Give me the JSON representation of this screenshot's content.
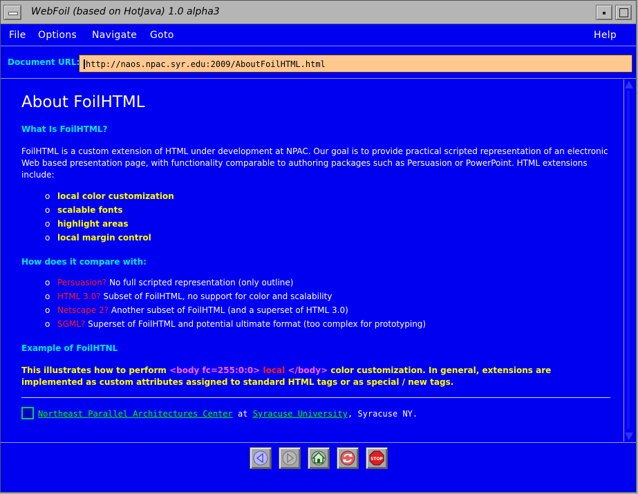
{
  "window": {
    "title": "WebFoil (based on HotJava) 1.0 alpha3"
  },
  "menubar": {
    "file": "File",
    "options": "Options",
    "navigate": "Navigate",
    "goto": "Goto",
    "help": "Help"
  },
  "url": {
    "label": "Document URL:",
    "value": "http://naos.npac.syr.edu:2009/AboutFoilHTML.html"
  },
  "page": {
    "title": "About FoilHTML",
    "section1_heading": "What Is FoilHTML?",
    "intro": "FoilHTML is a custom extension of HTML under development at NPAC. Our goal is to provide practical scripted representation of an electronic Web based presentation page, with functionality comparable to authoring packages such as Persuasion or PowerPoint. HTML extensions include:",
    "bullet_marker": "o",
    "features": [
      "local color customization",
      "scalable fonts",
      "highlight areas",
      "local margin control"
    ],
    "section2_heading": "How does it compare with:",
    "comparisons": [
      {
        "name": "Persuasion?",
        "desc": "No full scripted representation (only outline)"
      },
      {
        "name": "HTML 3.0?",
        "desc": "Subset of FoilHTML, no support for color and scalability"
      },
      {
        "name": "Netscape 2?",
        "desc": "Another subset of FoilHTML (and a superset of HTML 3.0)"
      },
      {
        "name": "SGML?",
        "desc": "Superset of FoilHTML and potential ultimate format (too complex for prototyping)"
      }
    ],
    "section3_heading": "Example of FoilHTNL",
    "example": {
      "before": "This illustrates how to perform ",
      "tag_open": "<body fc=255:0:0>",
      "local": "local",
      "tag_close": "</body>",
      "after": " color customization. In general, extensions are implemented as custom attributes assigned to standard HTML tags or as special / new tags."
    },
    "footer": {
      "npac_link": "Northeast Parallel Architectures Center",
      "at": "at",
      "su_link": "Syracuse University",
      "suffix": ", Syracuse NY."
    }
  },
  "toolbar": {
    "back": "back-icon",
    "forward": "forward-icon",
    "home": "home-icon",
    "reload": "reload-icon",
    "stop_label": "STOP"
  },
  "colors": {
    "background": "#0000f0",
    "heading": "#00e8e8",
    "feature": "#ffff00",
    "compare_name": "#ff2020",
    "link": "#00ff00",
    "url_field": "#ffc890"
  }
}
